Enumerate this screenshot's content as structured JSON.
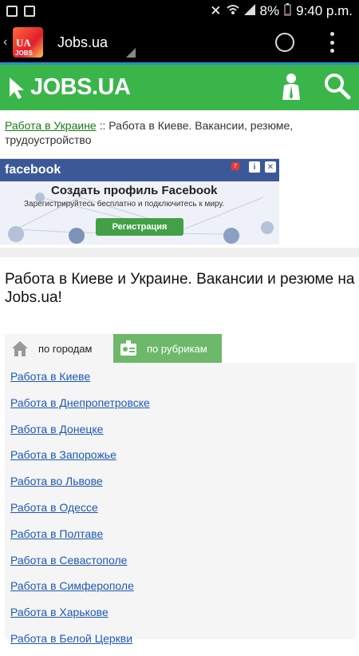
{
  "status": {
    "battery": "8%",
    "time": "9:40 p.m."
  },
  "appbar": {
    "icon_ua": "UA",
    "icon_jobs": "JOBS",
    "title": "Jobs.ua"
  },
  "header": {
    "logo_text": "JOBS.UA",
    "accent": "#3ab54a"
  },
  "breadcrumb": {
    "link": "Работа в Украине",
    "separator": " :: ",
    "rest": "Работа в Киеве. Вакансии, резюме, трудоустройство"
  },
  "ad": {
    "brand": "facebook",
    "title": "Создать профиль Facebook",
    "subtitle": "Зарегистрируйтесь бесплатно и подключитесь к миру.",
    "button": "Регистрация",
    "badge": "7"
  },
  "page": {
    "title": "Работа в Киеве и Украине. Вакансии и резюме на Jobs.ua!"
  },
  "tabs": [
    {
      "label": "по городам"
    },
    {
      "label": "по рубрикам"
    }
  ],
  "cities": [
    "Работа в Киеве",
    "Работа в Днепропетровске",
    "Работа в Донецке",
    "Работа в Запорожье",
    "Работа во Львове",
    "Работа в Одессе",
    "Работа в Полтаве",
    "Работа в Севастополе",
    "Работа в Симферополе",
    "Работа в Харькове",
    "Работа в Белой Церкви"
  ]
}
